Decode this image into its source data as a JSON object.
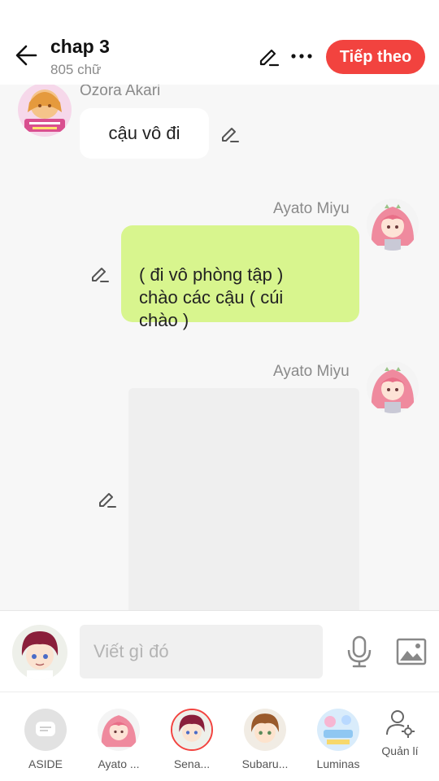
{
  "header": {
    "title": "chap 3",
    "word_count": "805 chữ",
    "next_label": "Tiếp theo"
  },
  "messages": [
    {
      "sender": "Ozora Akari",
      "side": "left",
      "text": "cậu vô đi",
      "bubble_color": "#ffffff"
    },
    {
      "sender": "Ayato  Miyu",
      "side": "right",
      "text": "( đi vô phòng tập )\nchào các cậu ( cúi\nchào )",
      "bubble_color": "#d8f58e"
    },
    {
      "sender": "Ayato  Miyu",
      "side": "right",
      "text": "",
      "bubble_color": "#efefef",
      "type": "image"
    }
  ],
  "composer": {
    "placeholder": "Viết gì đó"
  },
  "characters": [
    {
      "label": "ASIDE"
    },
    {
      "label": "Ayato ..."
    },
    {
      "label": "Sena..."
    },
    {
      "label": "Subaru..."
    },
    {
      "label": "Luminas"
    },
    {
      "label": "Quản lí"
    }
  ],
  "colors": {
    "accent": "#f2433f",
    "my_bubble": "#d8f58e",
    "other_bubble": "#ffffff",
    "background": "#f7f7f7"
  },
  "icons": {
    "back": "arrow-left-icon",
    "edit": "pencil-icon",
    "more": "more-horizontal-icon",
    "mic": "microphone-icon",
    "image": "image-icon",
    "manage": "user-gear-icon"
  }
}
